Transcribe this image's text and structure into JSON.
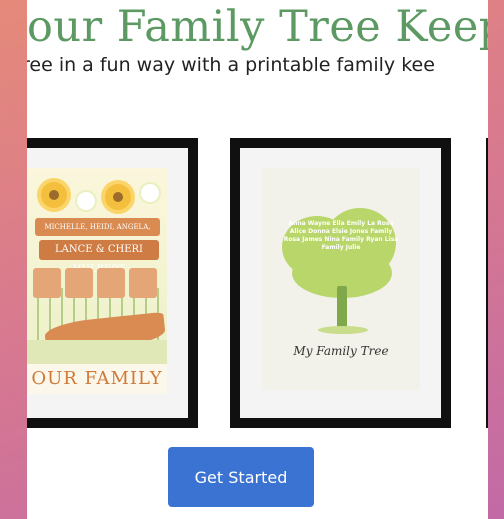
{
  "hero": {
    "title": "our Family Tree Keep",
    "subtitle": "ree in a fun way with a printable family kee"
  },
  "gallery": {
    "frame1": {
      "names": "MICHELLE, HEIDI, ANGELA, PAUL",
      "couple": "LANCE & CHERI HULBERT",
      "caption": "OUR FAMILY"
    },
    "frame2": {
      "tree_words": "Anna Wayne Ella Emily La Rose Alice Donna Elsie Jones Family Rosa James Nina Family Ryan Lisa Family Julie",
      "caption": "My Family Tree"
    }
  },
  "cta": {
    "label": "Get Started",
    "color": "#3b73d3"
  }
}
